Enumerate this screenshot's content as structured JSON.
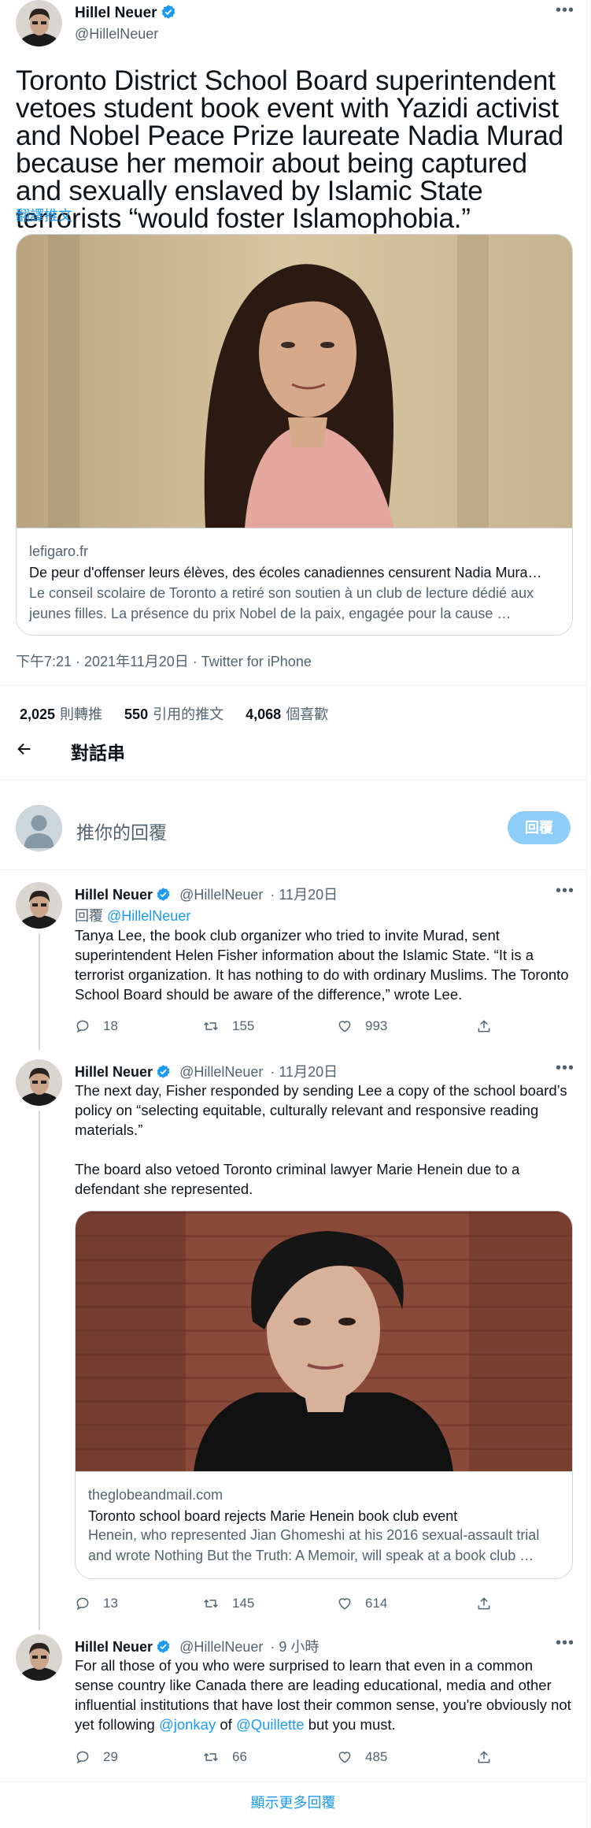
{
  "main_tweet": {
    "author_name": "Hillel Neuer",
    "author_handle": "@HillelNeuer",
    "text": "Toronto District School Board superintendent vetoes student book event with Yazidi activist and Nobel Peace Prize laureate Nadia Murad because her memoir about being captured and sexually enslaved by Islamic State terrorists “would foster Islamophobia.”",
    "translate_label": "翻譯推文",
    "card": {
      "domain": "lefigaro.fr",
      "title": "De peur d'offenser leurs élèves, des écoles canadiennes censurent Nadia Mura…",
      "description": "Le conseil scolaire de Toronto a retiré son soutien à un club de lecture dédié aux jeunes filles. La présence du prix Nobel de la paix, engagée pour la cause …"
    },
    "timestamp": "下午7:21 · 2021年11月20日 · Twitter for iPhone",
    "stats": {
      "retweets_count": "2,025",
      "retweets_label": "則轉推",
      "quotes_count": "550",
      "quotes_label": "引用的推文",
      "likes_count": "4,068",
      "likes_label": "個喜歡"
    }
  },
  "thread_header": {
    "title": "對話串"
  },
  "compose": {
    "placeholder": "推你的回覆",
    "reply_button": "回覆"
  },
  "replies": [
    {
      "author_name": "Hillel Neuer",
      "author_handle": "@HillelNeuer",
      "time": "· 11月20日",
      "replying_prefix": "回覆",
      "replying_to": "@HillelNeuer",
      "text": "Tanya Lee, the book club organizer who tried to invite Murad, sent superintendent Helen Fisher information about the Islamic State. “It is a terrorist organization. It has nothing to do with ordinary Muslims. The Toronto School Board should be aware of the difference,” wrote Lee.",
      "replies": "18",
      "retweets": "155",
      "likes": "993"
    },
    {
      "author_name": "Hillel Neuer",
      "author_handle": "@HillelNeuer",
      "time": "· 11月20日",
      "text_p1": "The next day, Fisher responded by sending Lee a copy of the school board’s policy on “selecting equitable, culturally relevant and responsive reading materials.”",
      "text_p2": "The board also vetoed Toronto criminal lawyer Marie Henein due to a defendant she represented.",
      "card": {
        "domain": "theglobeandmail.com",
        "title": "Toronto school board rejects Marie Henein book club event",
        "description": "Henein, who represented Jian Ghomeshi at his 2016 sexual-assault trial and wrote Nothing But the Truth: A Memoir, will speak at a book club …"
      },
      "replies": "13",
      "retweets": "145",
      "likes": "614"
    },
    {
      "author_name": "Hillel Neuer",
      "author_handle": "@HillelNeuer",
      "time": "· 9 小時",
      "text_a": "For all those of you who were surprised to learn that even in a common sense country like Canada there are leading educational, media and other influential institutions that have lost their common sense, you're obviously not yet following ",
      "mention1": "@jonkay",
      "text_b": " of ",
      "mention2": "@Quillette",
      "text_c": " but you must.",
      "replies": "29",
      "retweets": "66",
      "likes": "485"
    }
  ],
  "show_more": "顯示更多回覆",
  "colors": {
    "accent": "#1d9bf0",
    "secondary_text": "#536471",
    "border": "#cfd9de"
  }
}
